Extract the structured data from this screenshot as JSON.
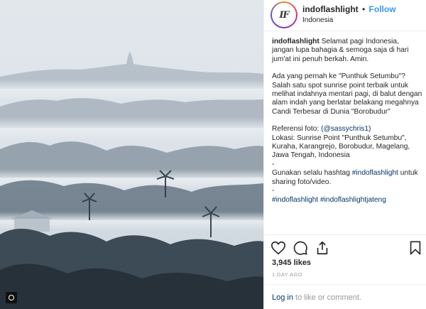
{
  "post": {
    "username": "indoflashlight",
    "follow_label": "Follow",
    "separator": "•",
    "location": "Indonesia",
    "avatar_text": "IF",
    "likes": "3,945 likes",
    "timestamp": "1 DAY AGO",
    "login_link": "Log in",
    "login_rest": " to like or comment.",
    "more_icon": "more-options-icon"
  },
  "caption": {
    "username": "indoflashlight",
    "intro": " Selamat pagi Indonesia, jangan lupa bahagia & semoga saja di hari jum'at ini penuh berkah. Amin.",
    "para2": "Ada yang pernah ke \"Punthuk Setumbu\"? Salah satu spot sunrise point terbaik untuk melihat indahnya mentari pagi, di balut dengan alam indah yang berlatar belakang megahnya Candi Terbesar di Dunia \"Borobudur\"",
    "ref_label": "Referensi foto: ",
    "ref_handle": "(@sassychris1)",
    "lokasi": "Lokasi: Sunrise Point \"Punthuk Setumbu\", Kuraha, Karangrejo, Borobudur, Magelang, Jawa Tengah, Indonesia",
    "dash1": "-",
    "hashtag_pre": "Gunakan selalu hashtag ",
    "hashtag_main": "#indoflashlight",
    "hashtag_post": " untuk sharing foto/video.",
    "dash2": "-",
    "tag1": "#indoflashlight",
    "tag2": "#indoflashlightjateng"
  },
  "icons": {
    "like": "heart-icon",
    "comment": "comment-icon",
    "share": "share-icon",
    "save": "bookmark-icon"
  },
  "colors": {
    "link_blue": "#3897f0",
    "hashtag_navy": "#003569",
    "muted": "#999999",
    "border": "#efefef"
  }
}
